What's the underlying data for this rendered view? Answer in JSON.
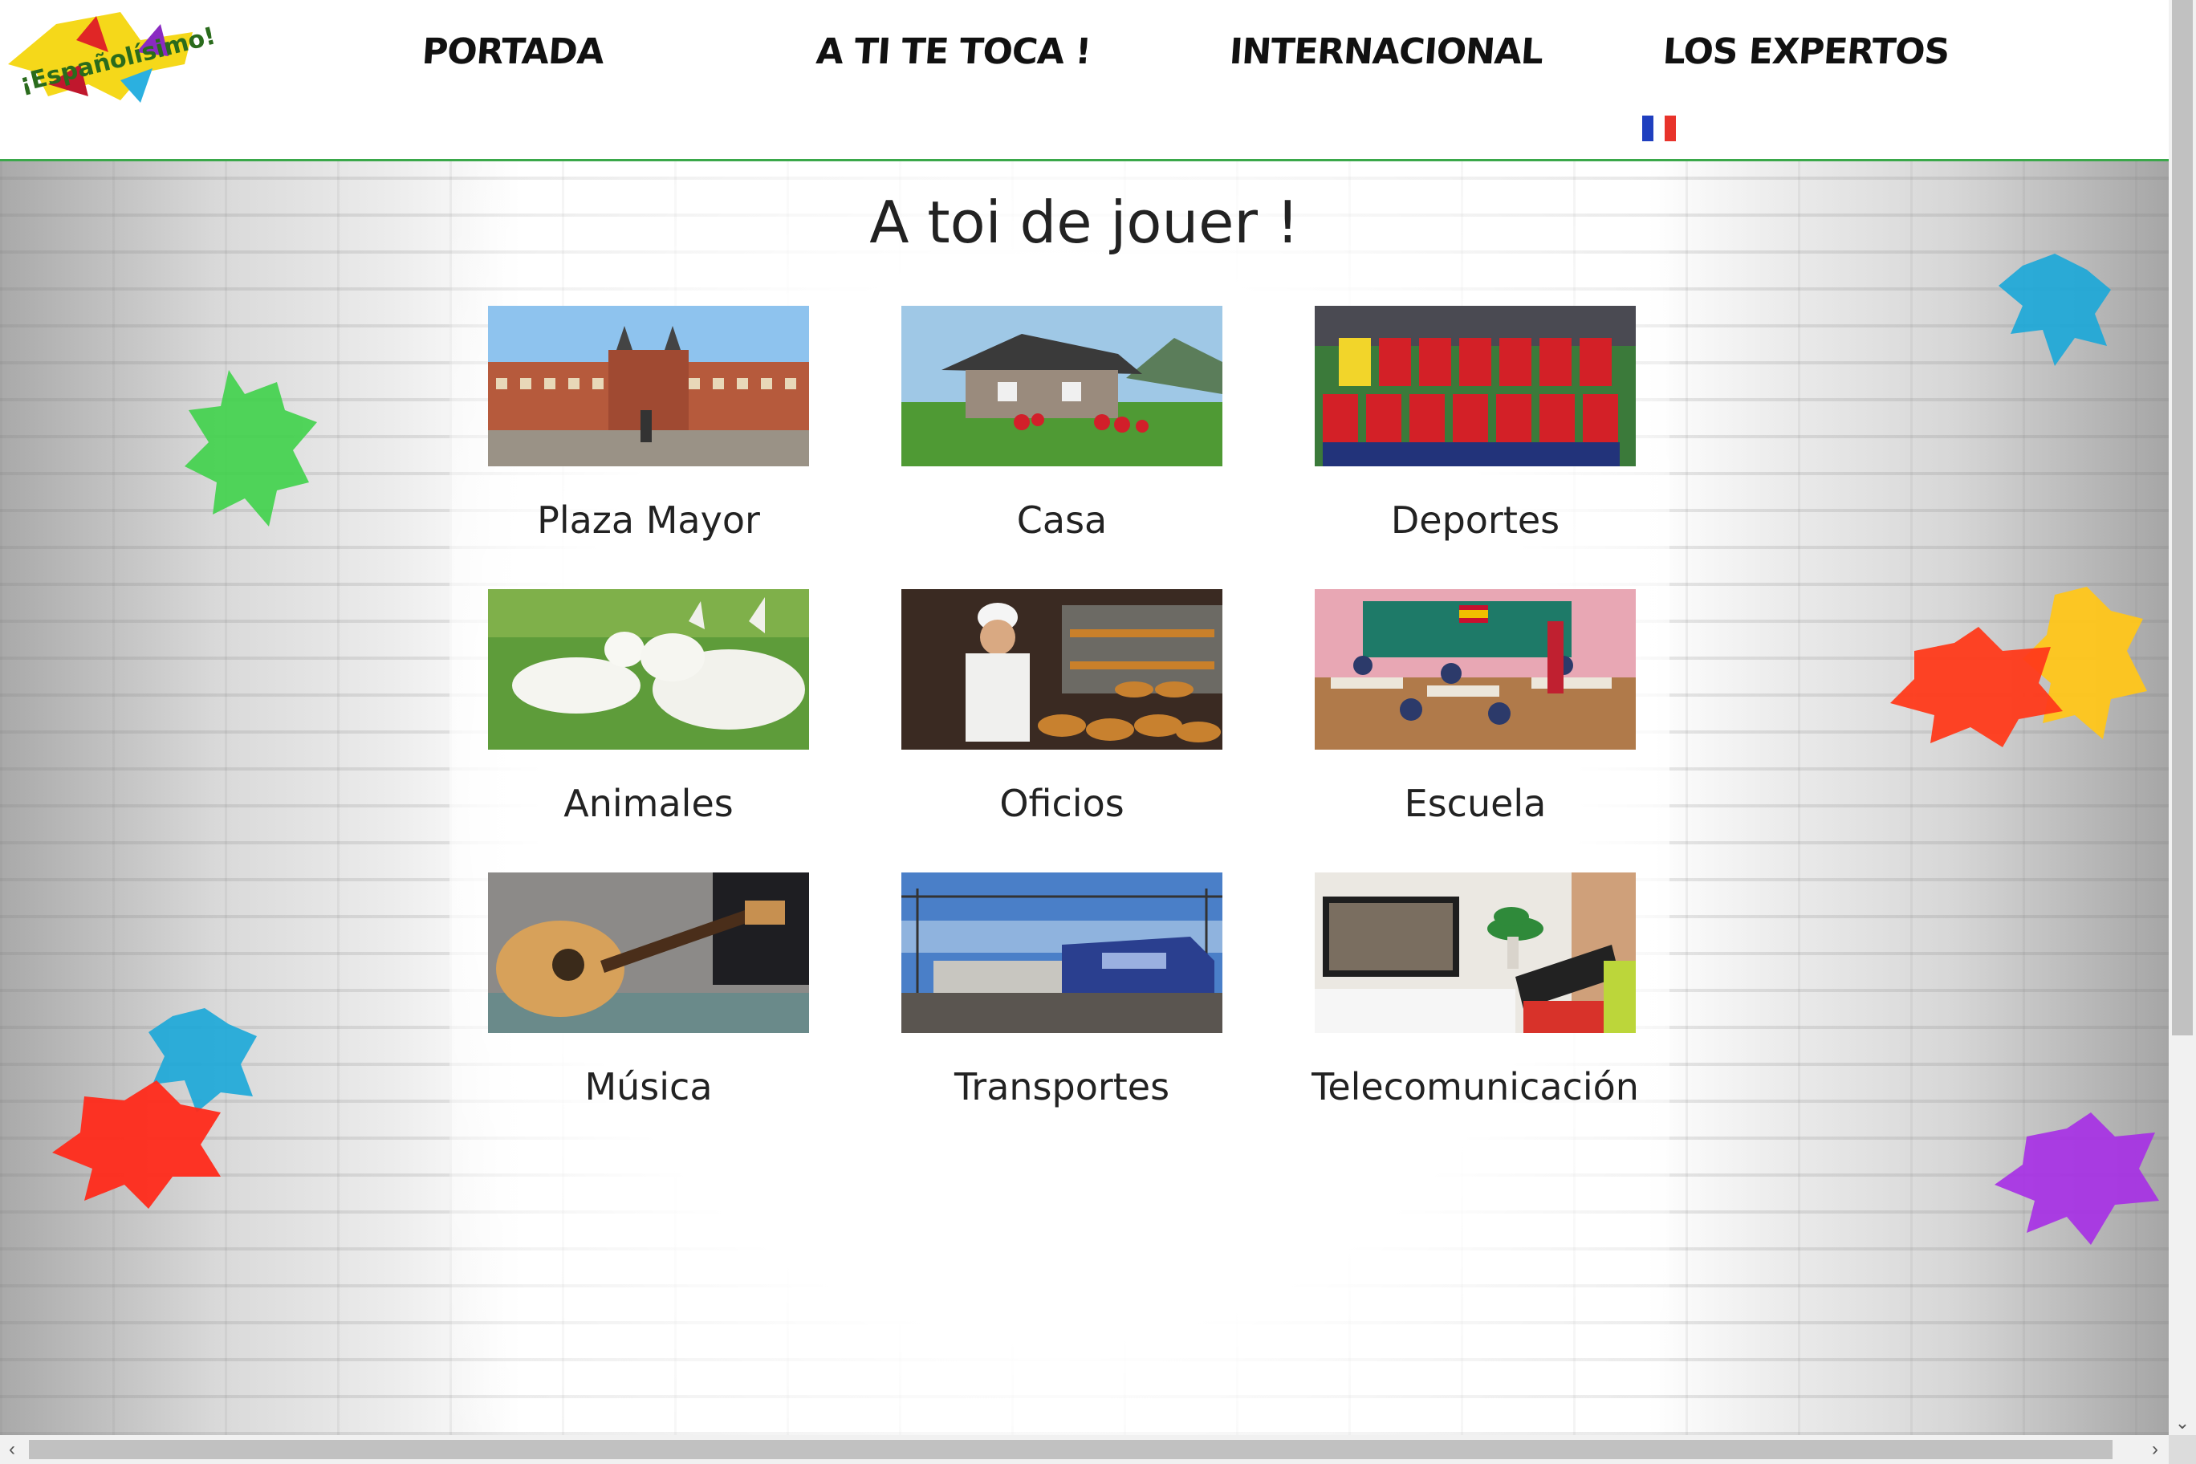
{
  "header": {
    "logo_text": "¡Españolísimo!",
    "nav": [
      "PORTADA",
      "A TI TE TOCA !",
      "INTERNACIONAL",
      "LOS EXPERTOS"
    ],
    "language_flag": "french-flag-icon"
  },
  "main": {
    "title": "A toi de jouer !",
    "topics": [
      {
        "label": "Plaza Mayor",
        "icon": "plaza-mayor-photo"
      },
      {
        "label": "Casa",
        "icon": "house-photo"
      },
      {
        "label": "Deportes",
        "icon": "football-team-photo"
      },
      {
        "label": "Animales",
        "icon": "animals-photo"
      },
      {
        "label": "Oficios",
        "icon": "baker-photo"
      },
      {
        "label": "Escuela",
        "icon": "classroom-photo"
      },
      {
        "label": "Música",
        "icon": "guitar-photo"
      },
      {
        "label": "Transportes",
        "icon": "train-photo"
      },
      {
        "label": "Telecomunicación",
        "icon": "devices-photo"
      }
    ]
  },
  "colors": {
    "header_border": "#3aa84a",
    "splat_green": "#3fd14a",
    "splat_blue": "#1aa7d8",
    "splat_orange": "#ff3a1a",
    "splat_yellow": "#ffc61a",
    "splat_purple": "#a62ee6"
  }
}
